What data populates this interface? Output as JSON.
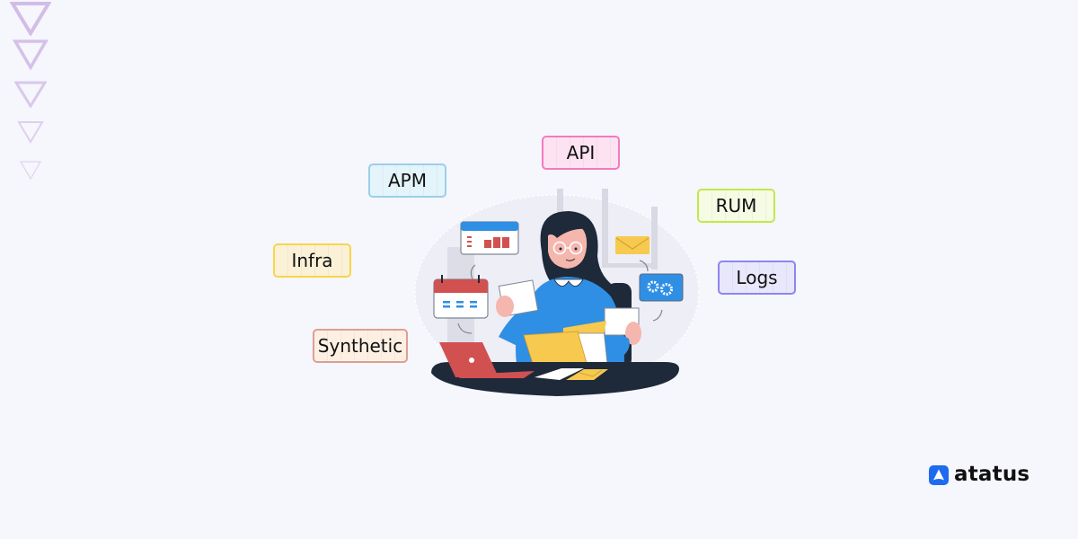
{
  "decorations": {
    "triangle_color": "#c9aee0"
  },
  "tags": [
    {
      "id": "apm",
      "label": "APM",
      "border": "#9ccfe8",
      "bg": "#e3f5fa"
    },
    {
      "id": "api",
      "label": "API",
      "border": "#f37ac0",
      "bg": "#fde3f1"
    },
    {
      "id": "rum",
      "label": "RUM",
      "border": "#c0ea4a",
      "bg": "#f6fbe4"
    },
    {
      "id": "infra",
      "label": "Infra",
      "border": "#f6d64a",
      "bg": "#fbf1d6"
    },
    {
      "id": "logs",
      "label": "Logs",
      "border": "#8d86ee",
      "bg": "#e9e7fb"
    },
    {
      "id": "synthetic",
      "label": "Synthetic",
      "border": "#dba093",
      "bg": "#fdf0e3"
    }
  ],
  "illustration": {
    "description": "woman at desk with folders, laptop and dashboard widgets"
  },
  "brand": {
    "name": "atatus",
    "logo_color": "#1f6bf0"
  }
}
